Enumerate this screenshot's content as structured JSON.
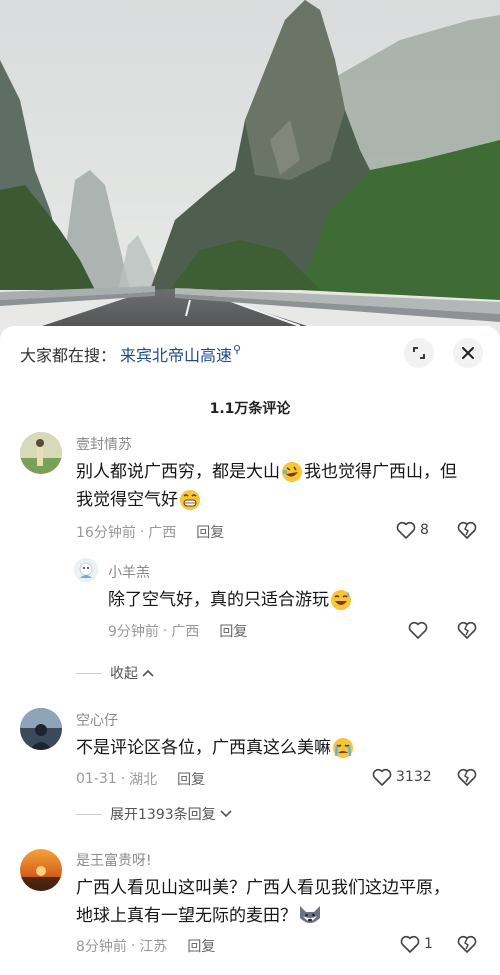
{
  "search": {
    "prefix": "大家都在搜：",
    "term": "来宾北帝山高速",
    "search_glyph": "⚲"
  },
  "comments_count": "1.1万条评论",
  "comments": [
    {
      "username": "壹封情苏",
      "text_line1_a": "别人都说广西穷，都是大山",
      "text_line1_b": "我也觉得广西山，但",
      "text_line2": "我觉得空气好",
      "time": "16分钟前",
      "location": "广西",
      "reply": "回复",
      "likes": "8",
      "emoji1": "rofl-emoji",
      "emoji2": "grin-emoji"
    },
    {
      "username": "小羊羔",
      "text": "除了空气好，真的只适合游玩",
      "time": "9分钟前",
      "location": "广西",
      "reply": "回复",
      "emoji": "sweat-smile-emoji"
    },
    {
      "username": "空心仔",
      "text": "不是评论区各位，广西真这么美嘛",
      "time": "01-31",
      "location": "湖北",
      "reply": "回复",
      "likes": "3132",
      "emoji": "cry-emoji"
    },
    {
      "username": "是王富贵呀!",
      "text_line1": "广西人看见山这叫美？广西人看见我们这边平原，",
      "text_line2": "地球上真有一望无际的麦田？",
      "time": "8分钟前",
      "location": "江苏",
      "reply": "回复",
      "likes": "1",
      "emoji": "husky-emoji"
    }
  ],
  "fold_label": "收起",
  "expand_label": "展开1393条回复",
  "meta_sep": "·",
  "colors": {
    "link_blue": "#1f4b8f",
    "muted": "#9a9a9a"
  }
}
